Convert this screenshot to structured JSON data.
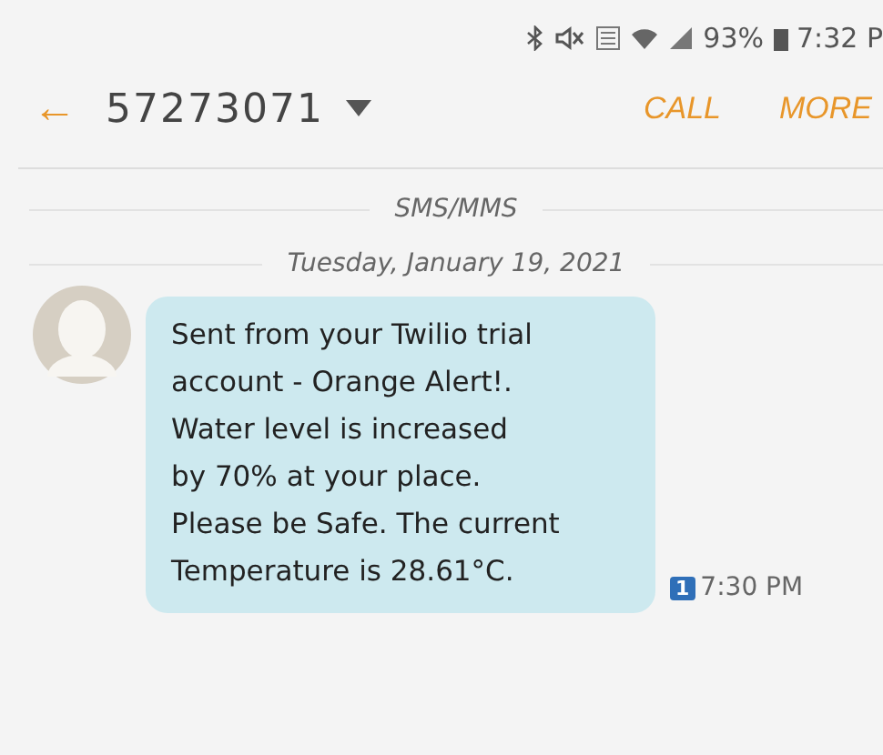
{
  "status_bar": {
    "battery": "93%",
    "time": "7:32 P"
  },
  "header": {
    "back": "←",
    "contact": "57273071",
    "actions": [
      "CALL",
      "MORE"
    ]
  },
  "channel_label": "SMS/MMS",
  "date_label": "Tuesday, January 19, 2021",
  "messages": [
    {
      "text": "Sent from your Twilio trial\naccount - Orange Alert!.\nWater level is increased\nby 70% at your place.\nPlease be Safe. The current\nTemperature is 28.61°C.",
      "sim": "1",
      "time": "7:30 PM"
    }
  ]
}
